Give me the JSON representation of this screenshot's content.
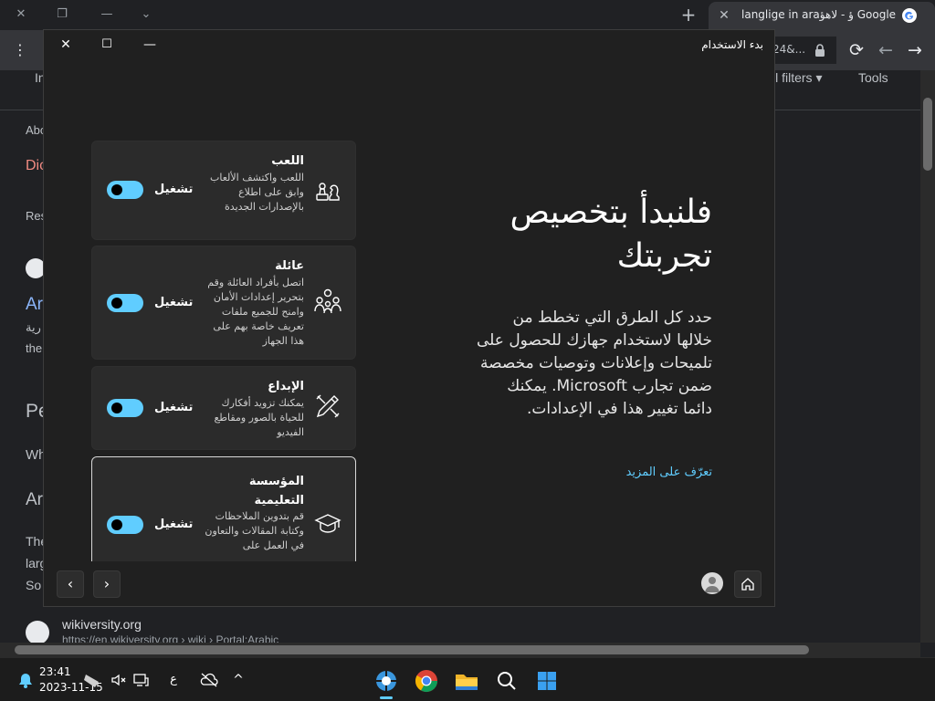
{
  "browser": {
    "tab": {
      "title": "langlige in araؤ - لاهؤ Google Sea",
      "close_glyph": "✕"
    },
    "new_tab_glyph": "+",
    "window_controls": {
      "close": "✕",
      "restore": "❐",
      "minimize": "—",
      "dropdown": "⌄"
    },
    "omnibox": {
      "text": "24&..."
    },
    "nav": {
      "reload": "⟳",
      "back": "←",
      "forward": "→",
      "menu": "⋮"
    },
    "page": {
      "filters": "ll filters ▾",
      "tools": "Tools",
      "items": [
        "In",
        "Abo",
        "Dic",
        "Res",
        "Ar",
        "رية",
        "the",
        "Pe",
        "Wh",
        "Ar",
        "The",
        "larg",
        "So"
      ],
      "result_site": "wikiversity.org",
      "result_url": "https://en.wikiversity.org › wiki › Portal:Arabic"
    }
  },
  "dialog": {
    "title": "بدء الاستخدام",
    "controls": {
      "close": "✕",
      "maximize": "☐",
      "minimize": "—"
    },
    "hero_title": "فلنبدأ بتخصيص تجربتك",
    "hero_description": "حدد كل الطرق التي تخطط من خلالها لاستخدام جهازك للحصول على تلميحات وإعلانات وتوصيات مخصصة ضمن تجارب Microsoft. يمكنك دائما تغيير هذا في الإعدادات.",
    "learn_more": "تعرّف على المزيد",
    "cards": [
      {
        "title": "اللعب",
        "description": "اللعب واكتشف الألعاب وابق على اطلاع بالإصدارات الجديدة",
        "toggle_label": "تشغيل",
        "icon": "gaming-icon",
        "on": true
      },
      {
        "title": "عائلة",
        "description": "اتصل بأفراد العائلة وقم بتحرير إعدادات الأمان وامنح للجميع ملفات تعريف خاصة بهم على هذا الجهاز",
        "toggle_label": "تشغيل",
        "icon": "family-icon",
        "on": true
      },
      {
        "title": "الإبداع",
        "description": "يمكنك تزويد أفكارك للحياة بالصور ومقاطع الفيديو",
        "toggle_label": "تشغيل",
        "icon": "creativity-icon",
        "on": true
      },
      {
        "title": "المؤسسة التعليمية",
        "description": "قم بتدوين الملاحظات وكتابة المقالات والتعاون في العمل على",
        "toggle_label": "تشغيل",
        "icon": "education-icon",
        "on": true
      }
    ],
    "footer": {
      "prev": "‹",
      "next": "›"
    }
  },
  "taskbar": {
    "time": "23:41",
    "date": "2023-11-15",
    "lang": "ع",
    "chevron": "^"
  },
  "colors": {
    "accent": "#60cdff",
    "dialog_bg": "#202020",
    "card_bg": "#2b2b2b"
  }
}
